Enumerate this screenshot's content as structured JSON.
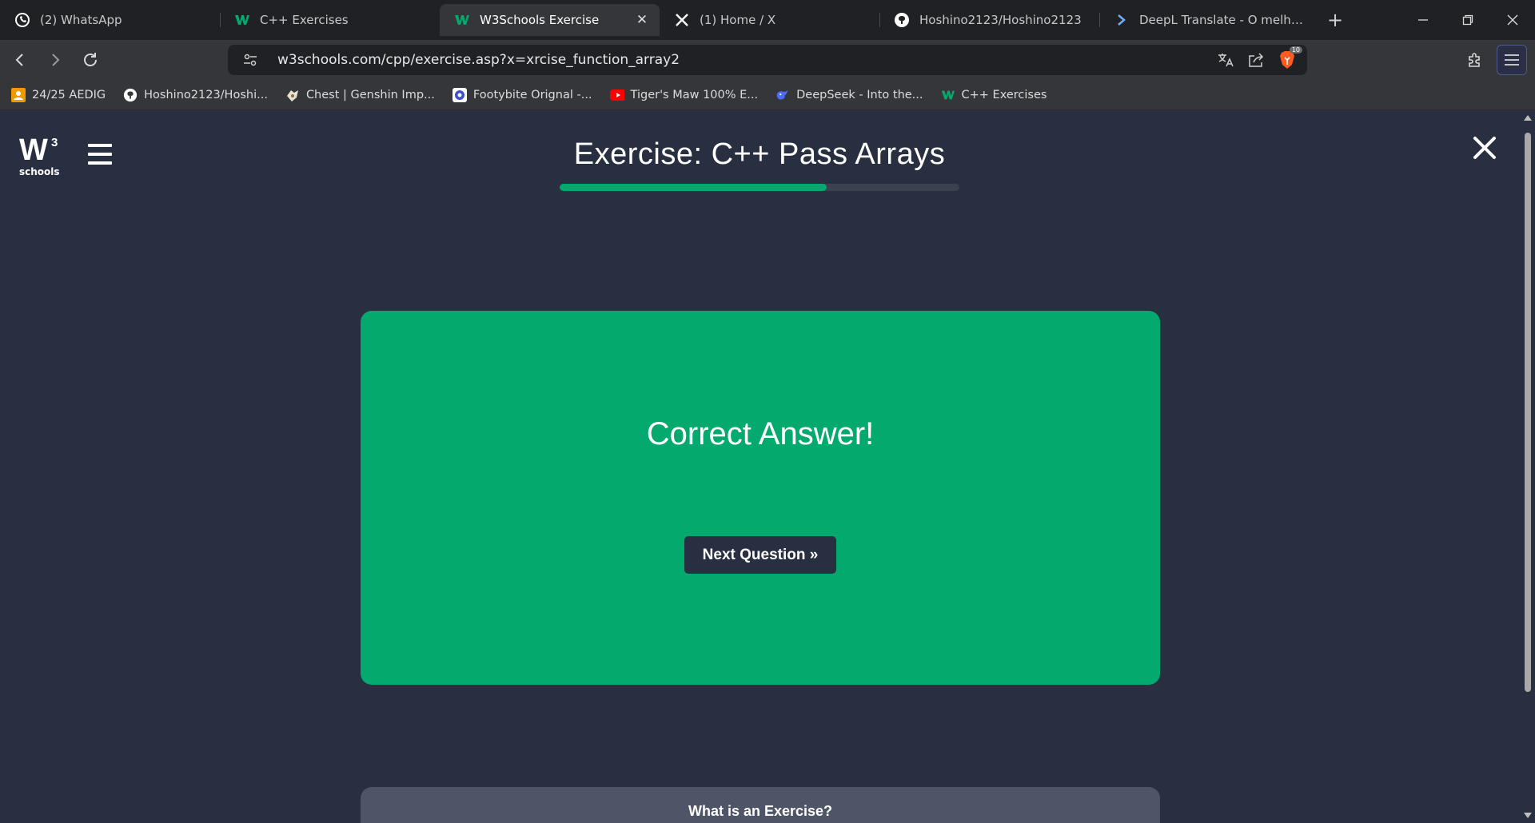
{
  "browser": {
    "tabs": [
      {
        "title": "(2) WhatsApp",
        "icon": "whatsapp-icon",
        "active": false
      },
      {
        "title": "C++ Exercises",
        "icon": "w3schools-icon",
        "active": false
      },
      {
        "title": "W3Schools Exercise",
        "icon": "w3schools-icon",
        "active": true
      },
      {
        "title": "(1) Home / X",
        "icon": "x-icon",
        "active": false
      },
      {
        "title": "Hoshino2123/Hoshino2123",
        "icon": "github-icon",
        "active": false
      },
      {
        "title": "DeepL Translate - O melhor tradutor",
        "icon": "deepl-icon",
        "active": false
      }
    ],
    "close_tab_glyph": "✕",
    "new_tab_glyph": "+",
    "url": "w3schools.com/cpp/exercise.asp?x=xrcise_function_array2",
    "shields_count": "10",
    "bookmarks": [
      {
        "label": "24/25 AEDIG",
        "icon": "classroom-icon"
      },
      {
        "label": "Hoshino2123/Hoshi...",
        "icon": "github-icon"
      },
      {
        "label": "Chest | Genshin Imp...",
        "icon": "genshin-icon"
      },
      {
        "label": "Footybite Orignal -...",
        "icon": "football-icon"
      },
      {
        "label": "Tiger's Maw 100% E...",
        "icon": "youtube-icon"
      },
      {
        "label": "DeepSeek - Into the...",
        "icon": "deepseek-icon"
      },
      {
        "label": "C++ Exercises",
        "icon": "w3schools-icon"
      }
    ]
  },
  "page": {
    "logo_text": "schools",
    "logo_mark": "W",
    "logo_sup": "3",
    "title": "Exercise: C++ Pass Arrays",
    "progress_fraction": 0.667,
    "result_text": "Correct Answer!",
    "next_button_label": "Next Question »",
    "info_title": "What is an Exercise?"
  },
  "colors": {
    "accent_green": "#04aa6d",
    "page_bg": "#282f41",
    "info_card_bg": "#4e5566"
  }
}
